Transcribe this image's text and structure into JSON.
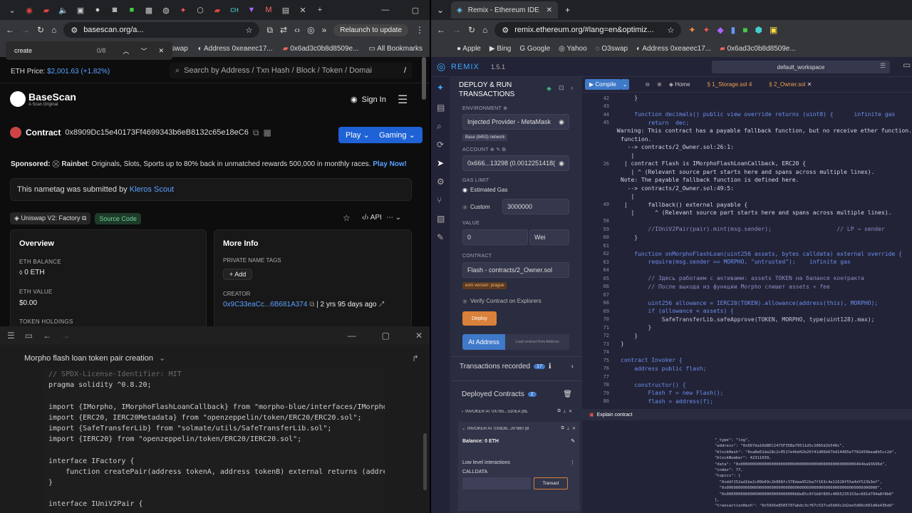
{
  "left_browser": {
    "find_query": "create",
    "find_count": "0/8",
    "url": "basescan.org/a...",
    "relaunch": "Relaunch to update",
    "bookmarks": [
      "3swap",
      "Address 0xeaeec17...",
      "0x6ad3c0b8d8509e...",
      "All Bookmarks"
    ],
    "eth_price_label": "ETH Price:",
    "eth_price_value": "$2,001.63 (+1.82%)",
    "search_placeholder": "Search by Address / Txn Hash / Block / Token / Domai",
    "search_shortcut": "/",
    "logo": "BaseScan",
    "logo_sub": "A Scan Original",
    "sign_in": "Sign In",
    "contract_label": "Contract",
    "contract_address": "0x8909Dc15e40173Ff4699343b6eB8132c65e18eC6",
    "play_btn": "Play",
    "gaming_btn": "Gaming",
    "sponsored_label": "Sponsored:",
    "sponsor_name": "Rainbet",
    "sponsor_text": ": Originals, Slots, Sports up to 80% back in unmatched rewards 500,000 in monthly races.",
    "sponsor_cta": "Play Now!",
    "nametag_text": "This nametag was submitted by",
    "nametag_link": "Kleros Scout",
    "tag1": "Uniswap V2: Factory",
    "tag2": "Source Code",
    "api": "API",
    "overview_title": "Overview",
    "eth_balance_label": "ETH BALANCE",
    "eth_balance_value": "0 ETH",
    "eth_value_label": "ETH VALUE",
    "eth_value_value": "$0.00",
    "token_holdings_label": "TOKEN HOLDINGS",
    "more_info_title": "More Info",
    "private_tags_label": "PRIVATE NAME TAGS",
    "add_btn": "+ Add",
    "creator_label": "CREATOR",
    "creator_addr": "0x9C33eaCc...6B681A374",
    "creator_time": "2 yrs 95 days ago"
  },
  "editor": {
    "title": "Morpho flash loan token pair creation",
    "lines": [
      {
        "t": "// SPDX-License-Identifier: MIT",
        "c": "cm"
      },
      {
        "t": "pragma solidity ^0.8.20;",
        "c": ""
      },
      {
        "t": "",
        "c": ""
      },
      {
        "t": "import {IMorpho, IMorphoFlashLoanCallback} from \"morpho-blue/interfaces/IMorpho.sol\"",
        "c": ""
      },
      {
        "t": "import {ERC20, IERC20Metadata} from \"openzeppelin/token/ERC20/ERC20.sol\";",
        "c": ""
      },
      {
        "t": "import {SafeTransferLib} from \"solmate/utils/SafeTransferLib.sol\";",
        "c": ""
      },
      {
        "t": "import {IERC20} from \"openzeppelin/token/ERC20/IERC20.sol\";",
        "c": ""
      },
      {
        "t": "",
        "c": ""
      },
      {
        "t": "interface IFactory {",
        "c": ""
      },
      {
        "t": "    function createPair(address tokenA, address tokenB) external returns (address pa",
        "c": ""
      },
      {
        "t": "}",
        "c": ""
      },
      {
        "t": "",
        "c": ""
      },
      {
        "t": "interface IUniV2Pair {",
        "c": ""
      }
    ]
  },
  "remix": {
    "tab_title": "Remix - Ethereum IDE",
    "url": "remix.ethereum.org/#lang=en&optimiz...",
    "bookmarks": [
      "Apple",
      "Bing",
      "Google",
      "Yahoo",
      "O3swap",
      "Address 0xeaeec17...",
      "0x6ad3c0b8d8509e..."
    ],
    "logo": "REMIX",
    "version": "1.5.1",
    "workspace": "default_workspace",
    "panel_title_1": "DEPLOY & RUN",
    "panel_title_2": "TRANSACTIONS",
    "env_label": "ENVIRONMENT",
    "env_value": "Injected Provider - MetaMask",
    "network": "Base (8453) network",
    "account_label": "ACCOUNT",
    "account_value": "0x666...13298 (0.0012251418(",
    "gas_label": "GAS LIMIT",
    "gas_estimated": "Estimated Gas",
    "gas_custom": "Custom",
    "gas_value": "3000000",
    "value_label": "VALUE",
    "value_amount": "0",
    "value_unit": "Wei",
    "contract_label": "CONTRACT",
    "contract_value": "Flash - contracts/2_Owner.sol",
    "evm": "evm version: prague",
    "verify": "Verify Contract on Explorers",
    "deploy": "Deploy",
    "at_address": "At Address",
    "load_contract": "Load contract from Address",
    "tx_recorded": "Transactions recorded",
    "tx_count": "17",
    "deployed": "Deployed Contracts",
    "deployed_count": "2",
    "inst1": "INVOKER AT 0X765...510EA (BL",
    "inst2": "INVOKER AT 0X8DB...AF980 (B",
    "balance": "Balance: 0 ETH",
    "low_level": "Low level interactions",
    "calldata": "CALLDATA",
    "transact": "Transact",
    "compile": "Compile",
    "tab_home": "Home",
    "tab_storage": "1_Storage.sol",
    "tab_storage_n": "4",
    "tab_owner": "2_Owner.sol",
    "code_lines": [
      {
        "n": "42",
        "t": "    }"
      },
      {
        "n": "43",
        "t": ""
      },
      {
        "n": "44",
        "t": "    function decimals() public view override returns (uint8) {      infinite gas"
      },
      {
        "n": "45",
        "t": "        return  dec;"
      },
      {
        "n": "",
        "t": "Warning: This contract has a payable fallback function, but no receive ether function."
      },
      {
        "n": "",
        "t": "function."
      },
      {
        "n": "",
        "t": "  --> contracts/2_Owner.sol:26:1:"
      },
      {
        "n": "",
        "t": "   |"
      },
      {
        "n": "26",
        "t": " | contract Flash is IMorphoFlashLoanCallback, ERC20 {"
      },
      {
        "n": "",
        "t": "   | ^ (Relevant source part starts here and spans across multiple lines)."
      },
      {
        "n": "",
        "t": "Note: The payable fallback function is defined here."
      },
      {
        "n": "",
        "t": "  --> contracts/2_Owner.sol:49:5:"
      },
      {
        "n": "",
        "t": "   |"
      },
      {
        "n": "49",
        "t": " |      fallback() external payable {"
      },
      {
        "n": "",
        "t": "   |      ^ (Relevant source part starts here and spans across multiple lines)."
      },
      {
        "n": "58",
        "t": ""
      },
      {
        "n": "59",
        "t": "        //IUniV2Pair(pair).mint(msg.sender);                   // LP → sender"
      },
      {
        "n": "60",
        "t": "    }"
      },
      {
        "n": "61",
        "t": ""
      },
      {
        "n": "62",
        "t": "    function onMorphoFlashLoan(uint256 assets, bytes calldata) external override {"
      },
      {
        "n": "63",
        "t": "        require(msg.sender == MORPHO, \"untrusted\");    infinite gas"
      },
      {
        "n": "64",
        "t": ""
      },
      {
        "n": "65",
        "t": "        // Здесь работаем с активами: assets TOKEN на балансе контракта"
      },
      {
        "n": "66",
        "t": "        // После выхода из функции Morpho спишет assets + fee"
      },
      {
        "n": "67",
        "t": ""
      },
      {
        "n": "68",
        "t": "        uint256 allowance = IERC20(TOKEN).allowance(address(this), MORPHO);"
      },
      {
        "n": "69",
        "t": "        if (allowance < assets) {"
      },
      {
        "n": "70",
        "t": "            SafeTransferLib.safeApprove(TOKEN, MORPHO, type(uint128).max);"
      },
      {
        "n": "71",
        "t": "        }"
      },
      {
        "n": "72",
        "t": "    }"
      },
      {
        "n": "73",
        "t": "}"
      },
      {
        "n": "74",
        "t": ""
      },
      {
        "n": "75",
        "t": "contract Invoker {"
      },
      {
        "n": "76",
        "t": "    address public flash;"
      },
      {
        "n": "77",
        "t": ""
      },
      {
        "n": "78",
        "t": "    constructor() {"
      },
      {
        "n": "79",
        "t": "        Flash f = new Flash();"
      },
      {
        "n": "80",
        "t": "        flash = address(f);"
      }
    ],
    "explain": "Explain contract",
    "term_lines": [
      "\"_type\": \"log\",",
      "\"address\": \"0x667da10d8EC2475F35Ba79511d5c2065d2b540c\",",
      "\"blockHash\": \"0xa8e61da18c2c0517e4bd42b26f41d06b67b414465e7702d59bea8b5cc2d\",",
      "\"blockNumber\": 42311039,",
      "\"data\": \"0x0000000000000000000000000000000000000000000000006464ba93696d\",",
      "\"index\": 77,",
      "\"topics\": [",
      "  \"0xddf252ad1be2c89b69c2b068fc378daa952ba7f163c4a11628f55a4df523b3ef\",",
      "  \"0x0000000000000000000000000000000000000000000000000000000000000000\",",
      "  \"0x00000000000000000000000000000b8e85c0f1b8f895c4665235153ec681d794a8f8b0\"",
      "],",
      "\"transactionHash\": \"0x59b5e8505707abdc3cf67c537ce5b69c2d2ee5d60c601d6e436dd\""
    ]
  }
}
